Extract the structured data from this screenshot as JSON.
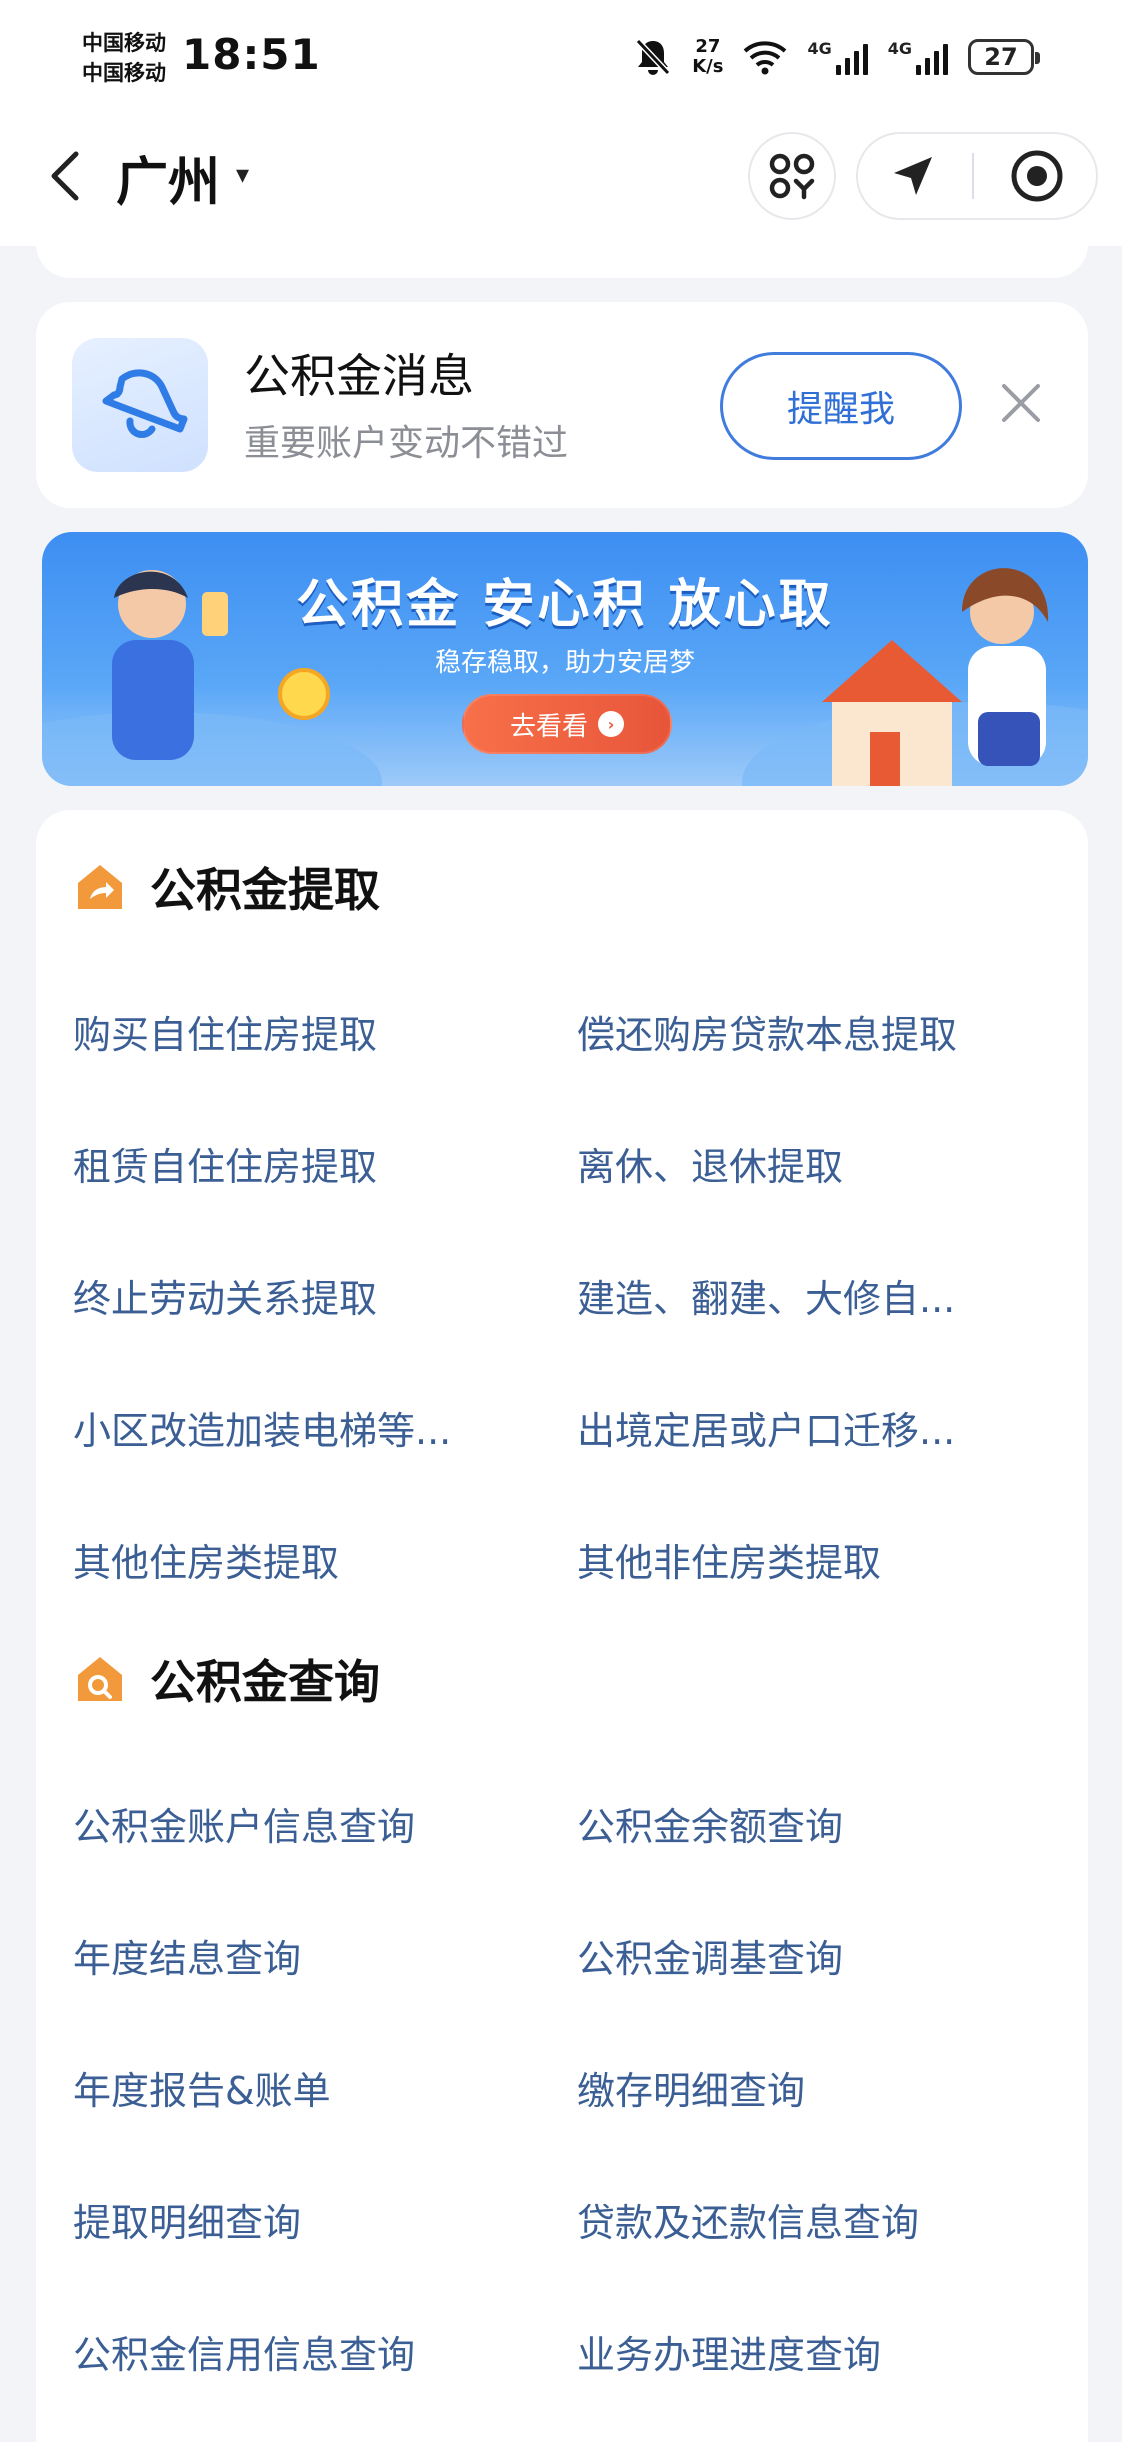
{
  "status_bar": {
    "carrier_1": "中国移动",
    "carrier_2": "中国移动",
    "time": "18:51",
    "net_speed_value": "27",
    "net_speed_unit": "K/s",
    "signal_1_label": "4G",
    "signal_2_label": "4G",
    "battery": "27"
  },
  "nav": {
    "city": "广州",
    "caret": "▾"
  },
  "notice": {
    "title": "公积金消息",
    "subtitle": "重要账户变动不错过",
    "button": "提醒我"
  },
  "banner": {
    "title": "公积金  安心积  放心取",
    "subtitle": "稳存稳取，助力安居梦",
    "button": "去看看"
  },
  "withdraw": {
    "title": "公积金提取",
    "items": [
      "购买自住住房提取",
      "偿还购房贷款本息提取",
      "租赁自住住房提取",
      "离休、退休提取",
      "终止劳动关系提取",
      "建造、翻建、大修自...",
      "小区改造加装电梯等...",
      "出境定居或户口迁移...",
      "其他住房类提取",
      "其他非住房类提取"
    ]
  },
  "query": {
    "title": "公积金查询",
    "items": [
      "公积金账户信息查询",
      "公积金余额查询",
      "年度结息查询",
      "公积金调基查询",
      "年度报告&账单",
      "缴存明细查询",
      "提取明细查询",
      "贷款及还款信息查询",
      "公积金信用信息查询",
      "业务办理进度查询"
    ]
  },
  "colors": {
    "accent": "#2f6fd6",
    "link_text": "#3b5f94",
    "section_icon": "#f29a3b",
    "banner_button": "#e8553a"
  },
  "icons": [
    "back-chevron-icon",
    "mute-bell-icon",
    "wifi-icon",
    "scan-icon",
    "location-arrow-icon",
    "target-icon",
    "bell-icon",
    "close-icon",
    "house-share-icon",
    "house-search-icon"
  ]
}
